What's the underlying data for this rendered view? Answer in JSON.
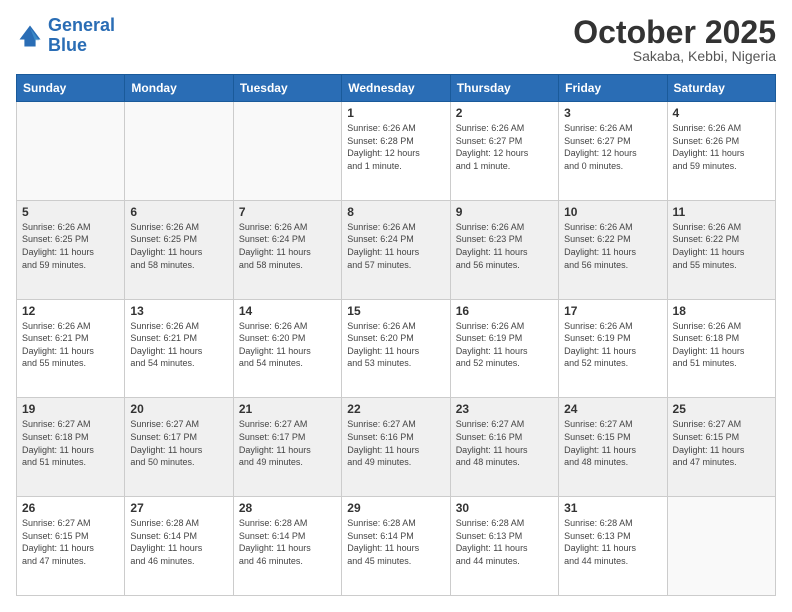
{
  "logo": {
    "line1": "General",
    "line2": "Blue"
  },
  "header": {
    "month": "October 2025",
    "location": "Sakaba, Kebbi, Nigeria"
  },
  "weekdays": [
    "Sunday",
    "Monday",
    "Tuesday",
    "Wednesday",
    "Thursday",
    "Friday",
    "Saturday"
  ],
  "weeks": [
    [
      {
        "day": "",
        "info": ""
      },
      {
        "day": "",
        "info": ""
      },
      {
        "day": "",
        "info": ""
      },
      {
        "day": "1",
        "info": "Sunrise: 6:26 AM\nSunset: 6:28 PM\nDaylight: 12 hours\nand 1 minute."
      },
      {
        "day": "2",
        "info": "Sunrise: 6:26 AM\nSunset: 6:27 PM\nDaylight: 12 hours\nand 1 minute."
      },
      {
        "day": "3",
        "info": "Sunrise: 6:26 AM\nSunset: 6:27 PM\nDaylight: 12 hours\nand 0 minutes."
      },
      {
        "day": "4",
        "info": "Sunrise: 6:26 AM\nSunset: 6:26 PM\nDaylight: 11 hours\nand 59 minutes."
      }
    ],
    [
      {
        "day": "5",
        "info": "Sunrise: 6:26 AM\nSunset: 6:25 PM\nDaylight: 11 hours\nand 59 minutes."
      },
      {
        "day": "6",
        "info": "Sunrise: 6:26 AM\nSunset: 6:25 PM\nDaylight: 11 hours\nand 58 minutes."
      },
      {
        "day": "7",
        "info": "Sunrise: 6:26 AM\nSunset: 6:24 PM\nDaylight: 11 hours\nand 58 minutes."
      },
      {
        "day": "8",
        "info": "Sunrise: 6:26 AM\nSunset: 6:24 PM\nDaylight: 11 hours\nand 57 minutes."
      },
      {
        "day": "9",
        "info": "Sunrise: 6:26 AM\nSunset: 6:23 PM\nDaylight: 11 hours\nand 56 minutes."
      },
      {
        "day": "10",
        "info": "Sunrise: 6:26 AM\nSunset: 6:22 PM\nDaylight: 11 hours\nand 56 minutes."
      },
      {
        "day": "11",
        "info": "Sunrise: 6:26 AM\nSunset: 6:22 PM\nDaylight: 11 hours\nand 55 minutes."
      }
    ],
    [
      {
        "day": "12",
        "info": "Sunrise: 6:26 AM\nSunset: 6:21 PM\nDaylight: 11 hours\nand 55 minutes."
      },
      {
        "day": "13",
        "info": "Sunrise: 6:26 AM\nSunset: 6:21 PM\nDaylight: 11 hours\nand 54 minutes."
      },
      {
        "day": "14",
        "info": "Sunrise: 6:26 AM\nSunset: 6:20 PM\nDaylight: 11 hours\nand 54 minutes."
      },
      {
        "day": "15",
        "info": "Sunrise: 6:26 AM\nSunset: 6:20 PM\nDaylight: 11 hours\nand 53 minutes."
      },
      {
        "day": "16",
        "info": "Sunrise: 6:26 AM\nSunset: 6:19 PM\nDaylight: 11 hours\nand 52 minutes."
      },
      {
        "day": "17",
        "info": "Sunrise: 6:26 AM\nSunset: 6:19 PM\nDaylight: 11 hours\nand 52 minutes."
      },
      {
        "day": "18",
        "info": "Sunrise: 6:26 AM\nSunset: 6:18 PM\nDaylight: 11 hours\nand 51 minutes."
      }
    ],
    [
      {
        "day": "19",
        "info": "Sunrise: 6:27 AM\nSunset: 6:18 PM\nDaylight: 11 hours\nand 51 minutes."
      },
      {
        "day": "20",
        "info": "Sunrise: 6:27 AM\nSunset: 6:17 PM\nDaylight: 11 hours\nand 50 minutes."
      },
      {
        "day": "21",
        "info": "Sunrise: 6:27 AM\nSunset: 6:17 PM\nDaylight: 11 hours\nand 49 minutes."
      },
      {
        "day": "22",
        "info": "Sunrise: 6:27 AM\nSunset: 6:16 PM\nDaylight: 11 hours\nand 49 minutes."
      },
      {
        "day": "23",
        "info": "Sunrise: 6:27 AM\nSunset: 6:16 PM\nDaylight: 11 hours\nand 48 minutes."
      },
      {
        "day": "24",
        "info": "Sunrise: 6:27 AM\nSunset: 6:15 PM\nDaylight: 11 hours\nand 48 minutes."
      },
      {
        "day": "25",
        "info": "Sunrise: 6:27 AM\nSunset: 6:15 PM\nDaylight: 11 hours\nand 47 minutes."
      }
    ],
    [
      {
        "day": "26",
        "info": "Sunrise: 6:27 AM\nSunset: 6:15 PM\nDaylight: 11 hours\nand 47 minutes."
      },
      {
        "day": "27",
        "info": "Sunrise: 6:28 AM\nSunset: 6:14 PM\nDaylight: 11 hours\nand 46 minutes."
      },
      {
        "day": "28",
        "info": "Sunrise: 6:28 AM\nSunset: 6:14 PM\nDaylight: 11 hours\nand 46 minutes."
      },
      {
        "day": "29",
        "info": "Sunrise: 6:28 AM\nSunset: 6:14 PM\nDaylight: 11 hours\nand 45 minutes."
      },
      {
        "day": "30",
        "info": "Sunrise: 6:28 AM\nSunset: 6:13 PM\nDaylight: 11 hours\nand 44 minutes."
      },
      {
        "day": "31",
        "info": "Sunrise: 6:28 AM\nSunset: 6:13 PM\nDaylight: 11 hours\nand 44 minutes."
      },
      {
        "day": "",
        "info": ""
      }
    ]
  ]
}
